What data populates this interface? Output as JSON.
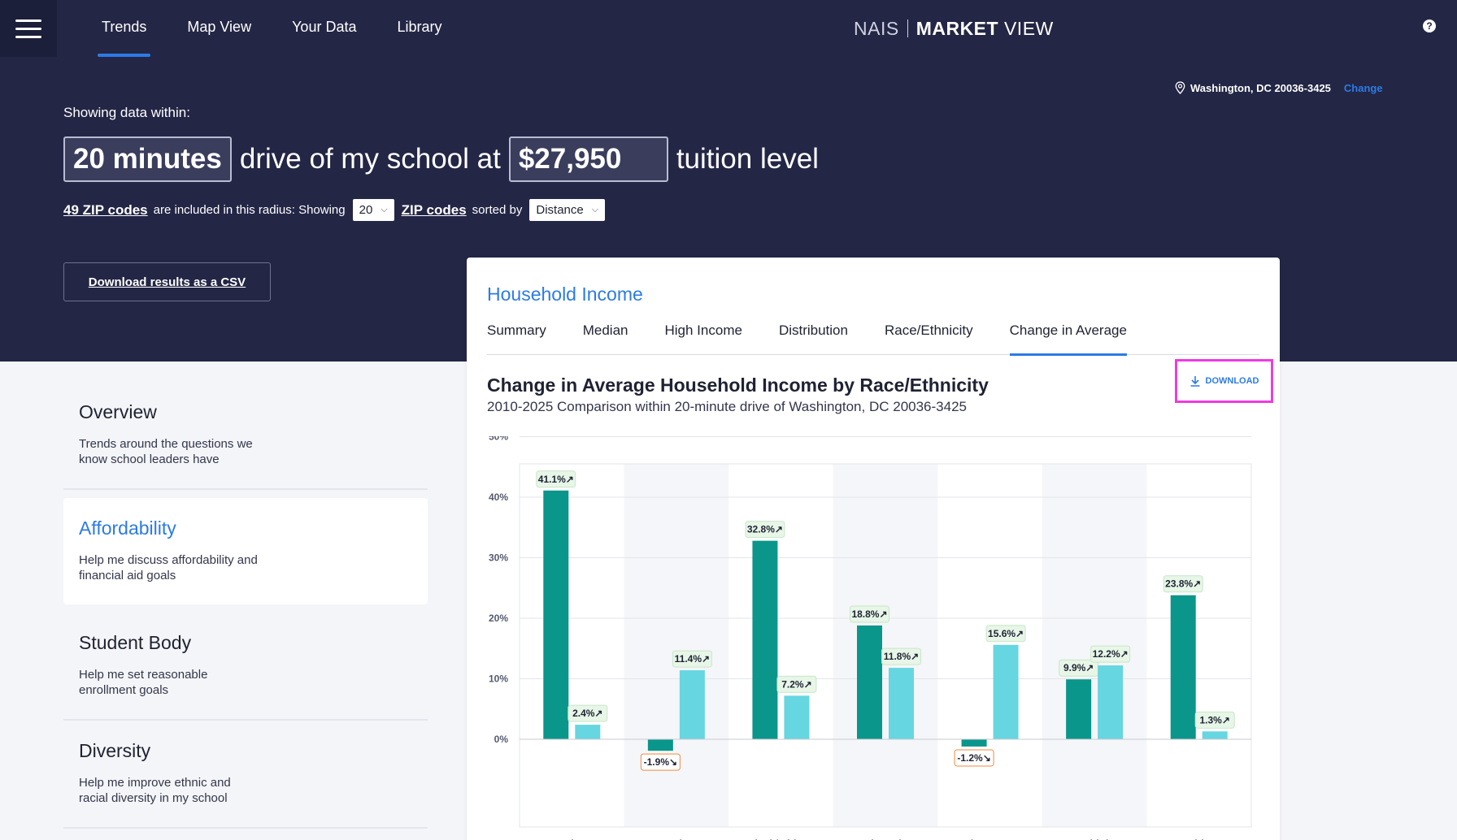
{
  "nav": {
    "items": [
      {
        "label": "Trends",
        "active": true
      },
      {
        "label": "Map View",
        "active": false
      },
      {
        "label": "Your Data",
        "active": false
      },
      {
        "label": "Library",
        "active": false
      }
    ],
    "brand_nais": "NAIS",
    "brand_market": "MARKET",
    "brand_view": "VIEW",
    "help": "?"
  },
  "location": {
    "text": "Washington, DC 20036-3425",
    "change": "Change"
  },
  "filters": {
    "showing_label": "Showing data within:",
    "drive_time": "20 minutes",
    "drive_text": "drive of my school at",
    "tuition": "$27,950",
    "tuition_text": "tuition level",
    "zip_count_link": "49 ZIP codes",
    "zip_text": "are included in this radius: Showing",
    "showing_count": "20",
    "zip_link": "ZIP codes",
    "sorted_by": "sorted by",
    "sort_value": "Distance"
  },
  "csv_button": "Download results as a CSV",
  "sidebar": {
    "items": [
      {
        "title": "Overview",
        "desc": "Trends around the questions we know school leaders have",
        "active": false
      },
      {
        "title": "Affordability",
        "desc": "Help me discuss affordability and financial aid goals",
        "active": true
      },
      {
        "title": "Student Body",
        "desc": "Help me set reasonable enrollment goals",
        "active": false
      },
      {
        "title": "Diversity",
        "desc": "Help me improve ethnic and racial diversity in my school",
        "active": false
      }
    ]
  },
  "card": {
    "title": "Household Income",
    "tabs": [
      "Summary",
      "Median",
      "High Income",
      "Distribution",
      "Race/Ethnicity",
      "Change in Average"
    ],
    "active_tab": "Change in Average",
    "download": "DOWNLOAD"
  },
  "chart_data": {
    "type": "bar",
    "title": "Change in Average Household Income by Race/Ethnicity",
    "subtitle": "2010-2025 Comparison within 20-minute drive of Washington, DC 20036-3425",
    "categories": [
      "Asian",
      "American Indian/Alaska",
      "Black/African American",
      "Hispanic",
      "Other Races",
      "Multiple",
      "White"
    ],
    "series": [
      {
        "values": [
          41.1,
          -1.9,
          32.8,
          18.8,
          -1.2,
          9.9,
          23.8
        ],
        "color": "#0a968a"
      },
      {
        "values": [
          2.4,
          11.4,
          7.2,
          11.8,
          15.6,
          12.2,
          1.3
        ],
        "color": "#66d6e0"
      }
    ],
    "y_ticks": [
      "50%",
      "40%",
      "30%",
      "20%",
      "10%",
      "0%"
    ],
    "ylim": [
      -10,
      50
    ],
    "grid": true,
    "alt_band_color": "#f5f6f9",
    "positive_label_bg": "#e7f6e7",
    "negative_label_border": "#f08a3c"
  }
}
